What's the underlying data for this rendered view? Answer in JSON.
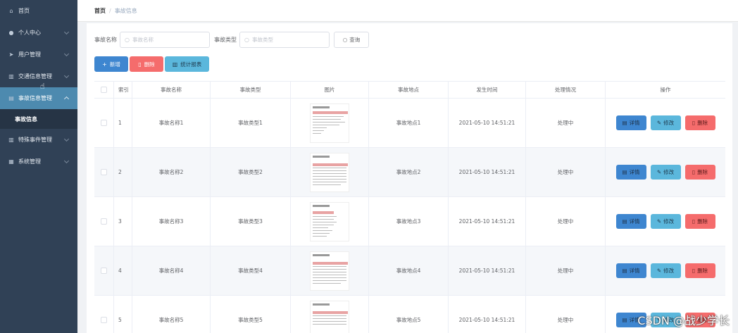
{
  "sidebar": {
    "items": [
      {
        "label": "首页",
        "icon": "home-icon",
        "glyph": "⌂",
        "has_chevron": false
      },
      {
        "label": "个人中心",
        "icon": "user-icon",
        "glyph": "●",
        "has_chevron": true
      },
      {
        "label": "用户管理",
        "icon": "send-icon",
        "glyph": "➤",
        "has_chevron": true
      },
      {
        "label": "交通信息管理",
        "icon": "chart-icon",
        "glyph": "▥",
        "has_chevron": true
      },
      {
        "label": "事故信息管理",
        "icon": "grid-icon",
        "glyph": "▤",
        "has_chevron": true,
        "active": true
      },
      {
        "label": "事故信息",
        "submenu": true
      },
      {
        "label": "特殊事件管理",
        "icon": "bar-chart-icon",
        "glyph": "▥",
        "has_chevron": true
      },
      {
        "label": "系统管理",
        "icon": "settings-grid-icon",
        "glyph": "▦",
        "has_chevron": true
      }
    ]
  },
  "breadcrumb": {
    "home": "首页",
    "separator": "/",
    "current": "事故信息"
  },
  "search": {
    "name_label": "事故名称",
    "name_placeholder": "事故名称",
    "type_label": "事故类型",
    "type_placeholder": "事故类型",
    "button": "查询"
  },
  "actions": {
    "add": "新增",
    "delete": "删除",
    "stats": "统计报表"
  },
  "table": {
    "headers": [
      "索引",
      "事故名称",
      "事故类型",
      "图片",
      "事故地点",
      "发生时间",
      "处理情况",
      "操作"
    ],
    "rows": [
      {
        "index": "1",
        "name": "事故名称1",
        "type": "事故类型1",
        "location": "事故地点1",
        "time": "2021-05-10 14:51:21",
        "status": "处理中"
      },
      {
        "index": "2",
        "name": "事故名称2",
        "type": "事故类型2",
        "location": "事故地点2",
        "time": "2021-05-10 14:51:21",
        "status": "处理中"
      },
      {
        "index": "3",
        "name": "事故名称3",
        "type": "事故类型3",
        "location": "事故地点3",
        "time": "2021-05-10 14:51:21",
        "status": "处理中"
      },
      {
        "index": "4",
        "name": "事故名称4",
        "type": "事故类型4",
        "location": "事故地点4",
        "time": "2021-05-10 14:51:21",
        "status": "处理中"
      },
      {
        "index": "5",
        "name": "事故名称5",
        "type": "事故类型5",
        "location": "事故地点5",
        "time": "2021-05-10 14:51:21",
        "status": "处理中"
      }
    ],
    "row_actions": {
      "detail": "详情",
      "edit": "修改",
      "remove": "删除"
    }
  },
  "watermark": "CSDN @战少学长",
  "colors": {
    "sidebar_bg": "#304156",
    "active_menu": "#4d8aaf",
    "primary": "#3e86d0",
    "danger": "#f56c6c",
    "info": "#5bb7dc"
  }
}
